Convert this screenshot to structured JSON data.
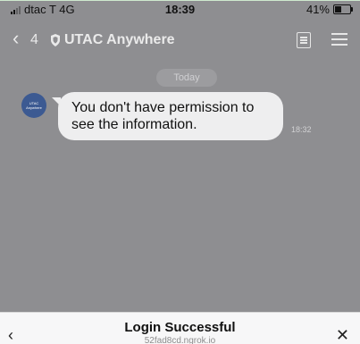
{
  "status_bar": {
    "carrier": "dtac T 4G",
    "time": "18:39",
    "battery": "41%",
    "battery_level": 0.41
  },
  "chat_header": {
    "back_count": "4",
    "title": "UTAC Anywhere"
  },
  "conversation": {
    "date_label": "Today",
    "avatar_text": "UTAC Anywhere",
    "message": "You don't have permission to see the information.",
    "message_time": "18:32"
  },
  "bottom_sheet": {
    "title": "Login Successful",
    "subtitle": "52fad8cd.ngrok.io"
  },
  "icons": {
    "back": "chevron-left-icon",
    "shield": "shield-icon",
    "document": "document-icon",
    "menu": "menu-icon",
    "close": "close-icon"
  },
  "colors": {
    "overlay": "#8e8e91",
    "bubble": "#eeeeef",
    "avatar": "#3c5a92"
  }
}
